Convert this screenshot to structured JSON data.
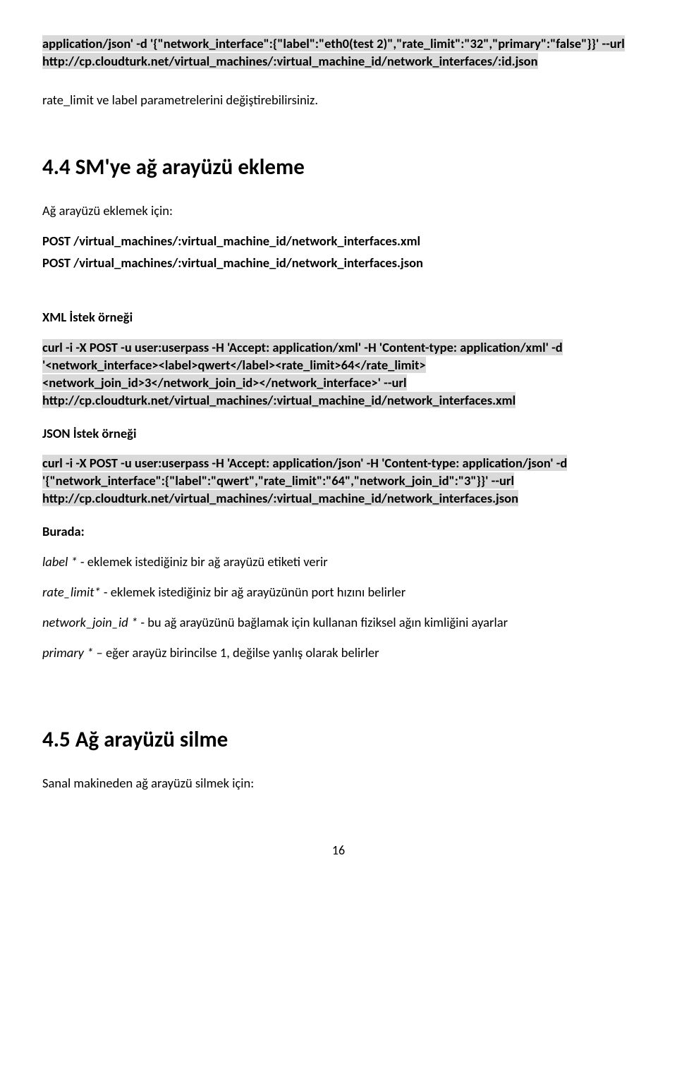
{
  "intro": {
    "line1": "application/json' -d '{\"network_interface\":{\"label\":\"eth0(test 2)\",\"rate_limit\":\"32\",\"primary\":\"false\"}}' --url http://cp.cloudturk.net/virtual_machines/:virtual_machine_id/network_interfaces/:id.json",
    "para1": "rate_limit ve label parametrelerini değiştirebilirsiniz."
  },
  "sec44": {
    "title": "4.4 SM'ye ağ arayüzü ekleme",
    "intro": "Ağ arayüzü eklemek için:",
    "post1": "POST   /virtual_machines/:virtual_machine_id/network_interfaces.xml",
    "post2": "POST   /virtual_machines/:virtual_machine_id/network_interfaces.json",
    "xml_h": "XML İstek örneği",
    "xml_code": "curl -i -X POST -u user:userpass -H 'Accept: application/xml' -H 'Content-type: application/xml' -d '<network_interface><label>qwert</label><rate_limit>64</rate_limit><network_join_id>3</network_join_id></network_interface>' --url http://cp.cloudturk.net/virtual_machines/:virtual_machine_id/network_interfaces.xml",
    "json_h": "JSON İstek örneği",
    "json_code": "curl -i -X POST -u user:userpass -H 'Accept: application/json' -H 'Content-type: application/json' -d '{\"network_interface\":{\"label\":\"qwert\",\"rate_limit\":\"64\",\"network_join_id\":\"3\"}}' --url http://cp.cloudturk.net/virtual_machines/:virtual_machine_id/network_interfaces.json",
    "burada": "Burada:",
    "d_label_i": "label *",
    "d_label_t": " - eklemek istediğiniz bir ağ arayüzü etiketi verir",
    "d_rate_i": "rate_limit*",
    "d_rate_t": " - eklemek istediğiniz bir ağ arayüzünün port hızını belirler",
    "d_join_i": "network_join_id *",
    "d_join_t": " - bu ağ arayüzünü bağlamak için kullanan fiziksel ağın kimliğini ayarlar",
    "d_prim_i": "primary *",
    "d_prim_t": " – eğer arayüz birincilse 1, değilse yanlış olarak belirler"
  },
  "sec45": {
    "title": "4.5 Ağ arayüzü silme",
    "intro": "Sanal makineden ağ arayüzü silmek için:"
  },
  "page_num": "16"
}
